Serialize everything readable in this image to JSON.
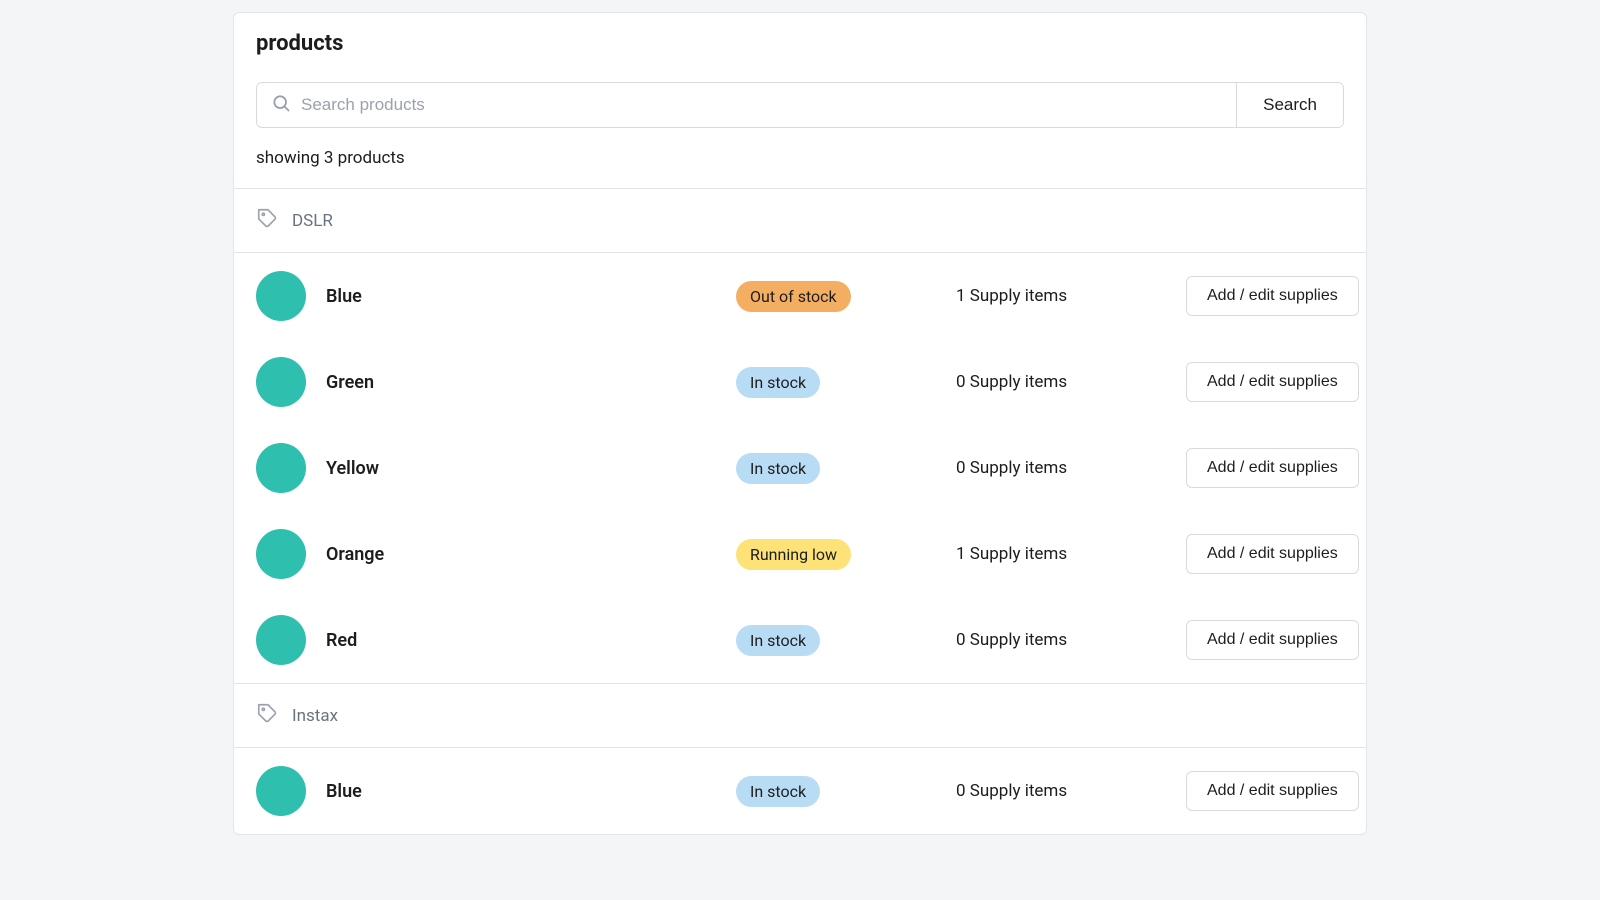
{
  "header": {
    "title": "products"
  },
  "search": {
    "placeholder": "Search products",
    "button": "Search"
  },
  "summary": "showing 3 products",
  "row_button_label": "Add / edit supplies",
  "badge_labels": {
    "out": "Out of stock",
    "in": "In stock",
    "low": "Running low"
  },
  "groups": [
    {
      "name": "DSLR",
      "items": [
        {
          "name": "Blue",
          "status": "out",
          "supply": "1 Supply items"
        },
        {
          "name": "Green",
          "status": "in",
          "supply": "0 Supply items"
        },
        {
          "name": "Yellow",
          "status": "in",
          "supply": "0 Supply items"
        },
        {
          "name": "Orange",
          "status": "low",
          "supply": "1 Supply items"
        },
        {
          "name": "Red",
          "status": "in",
          "supply": "0 Supply items"
        }
      ]
    },
    {
      "name": "Instax",
      "items": [
        {
          "name": "Blue",
          "status": "in",
          "supply": "0 Supply items"
        }
      ]
    }
  ]
}
